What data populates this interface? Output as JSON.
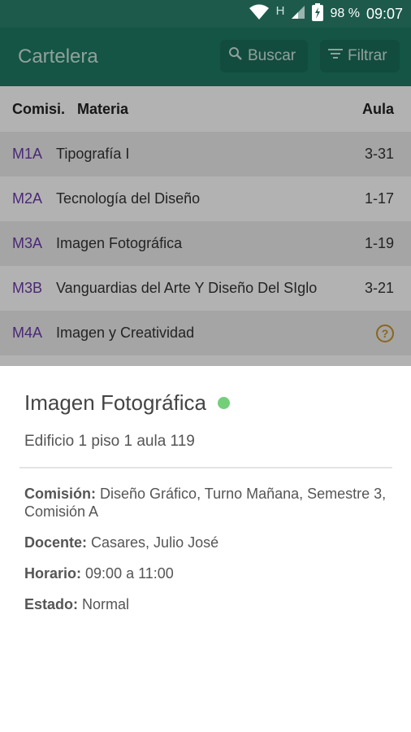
{
  "status_bar": {
    "network": "H",
    "battery": "98 %",
    "time": "09:07"
  },
  "app_bar": {
    "title": "Cartelera",
    "search_label": "Buscar",
    "filter_label": "Filtrar"
  },
  "table": {
    "headers": {
      "comision": "Comisi.",
      "materia": "Materia",
      "aula": "Aula"
    },
    "rows": [
      {
        "comision": "M1A",
        "materia": "Tipografía I",
        "aula": "3-31"
      },
      {
        "comision": "M2A",
        "materia": "Tecnología del Diseño",
        "aula": "1-17"
      },
      {
        "comision": "M3A",
        "materia": "Imagen Fotográfica",
        "aula": "1-19"
      },
      {
        "comision": "M3B",
        "materia": "Vanguardias del Arte Y Diseño Del SIglo",
        "aula": "3-21"
      },
      {
        "comision": "M4A",
        "materia": "Imagen y Creatividad",
        "aula_icon": "help-circle-icon"
      }
    ]
  },
  "detail_sheet": {
    "title": "Imagen Fotográfica",
    "status_color": "#74cf79",
    "subtitle": "Edificio 1 piso 1 aula 119",
    "comision_label": "Comisión:",
    "comision_value": "Diseño Gráfico, Turno Mañana, Semestre 3, Comisión A",
    "docente_label": "Docente:",
    "docente_value": "Casares, Julio José",
    "horario_label": "Horario:",
    "horario_value": "09:00 a 11:00",
    "estado_label": "Estado:",
    "estado_value": "Normal"
  },
  "colors": {
    "primary": "#1d7a63",
    "status_bar": "#1d5a4c",
    "commission_text": "#6a3aa8",
    "help_icon": "#c8922e"
  }
}
